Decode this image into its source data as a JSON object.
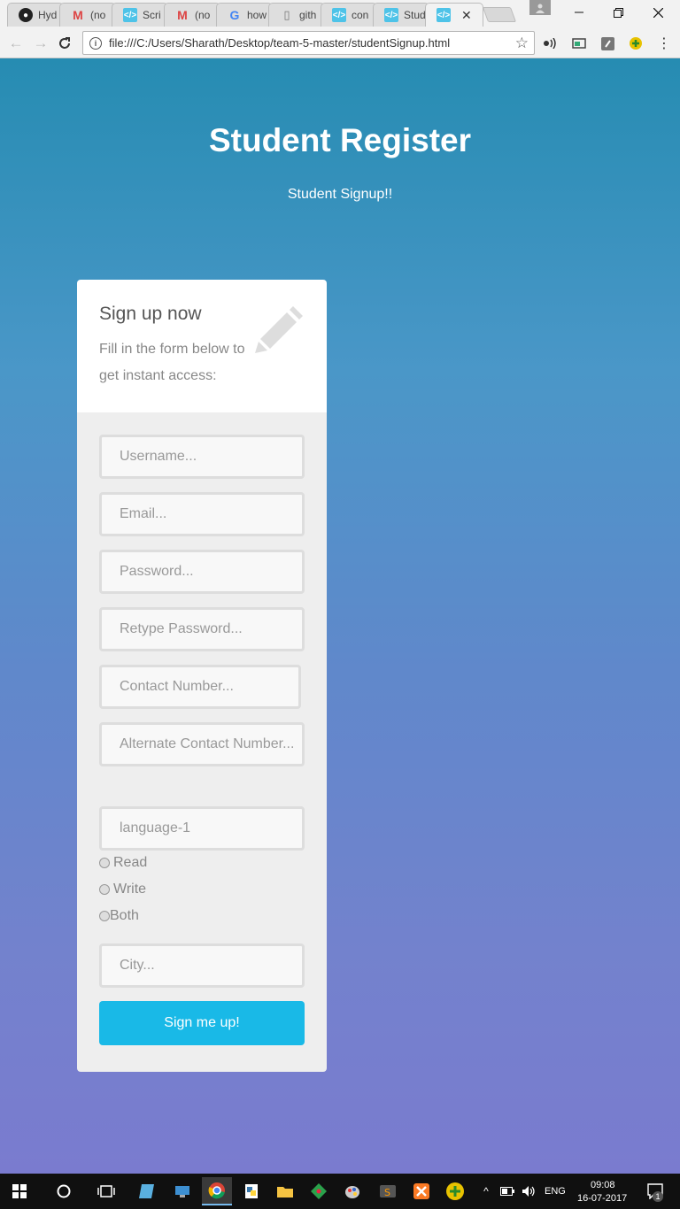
{
  "browser": {
    "tabs": [
      {
        "title": "Hyd",
        "icon": "github-icon"
      },
      {
        "title": "(no",
        "icon": "gmail-icon"
      },
      {
        "title": "Scri",
        "icon": "app-icon"
      },
      {
        "title": "(no",
        "icon": "gmail-icon"
      },
      {
        "title": "how",
        "icon": "google-icon"
      },
      {
        "title": "gith",
        "icon": "document-icon"
      },
      {
        "title": "con",
        "icon": "app-icon"
      },
      {
        "title": "Stud",
        "icon": "app-icon"
      }
    ],
    "active_tab_close": "✕",
    "url": "file:///C:/Users/Sharath/Desktop/team-5-master/studentSignup.html"
  },
  "page": {
    "title": "Student Register",
    "subtitle": "Student Signup!!"
  },
  "form": {
    "heading": "Sign up now",
    "description": "Fill in the form below to get instant access:",
    "username_placeholder": "Username...",
    "email_placeholder": "Email...",
    "password_placeholder": "Password...",
    "retype_password_placeholder": "Retype Password...",
    "contact_placeholder": "Contact Number...",
    "alt_contact_placeholder": "Alternate Contact Number...",
    "language_placeholder": "language-1",
    "radio_read": "Read",
    "radio_write": "Write",
    "radio_both": "Both",
    "city_placeholder": "City...",
    "submit_label": "Sign me up!"
  },
  "taskbar": {
    "language": "ENG",
    "time": "09:08",
    "date": "16-07-2017",
    "notifications": "1"
  },
  "colors": {
    "accent_button": "#19b9e7",
    "gradient_top": "#268cb2",
    "gradient_bottom": "#7a7bcf"
  }
}
